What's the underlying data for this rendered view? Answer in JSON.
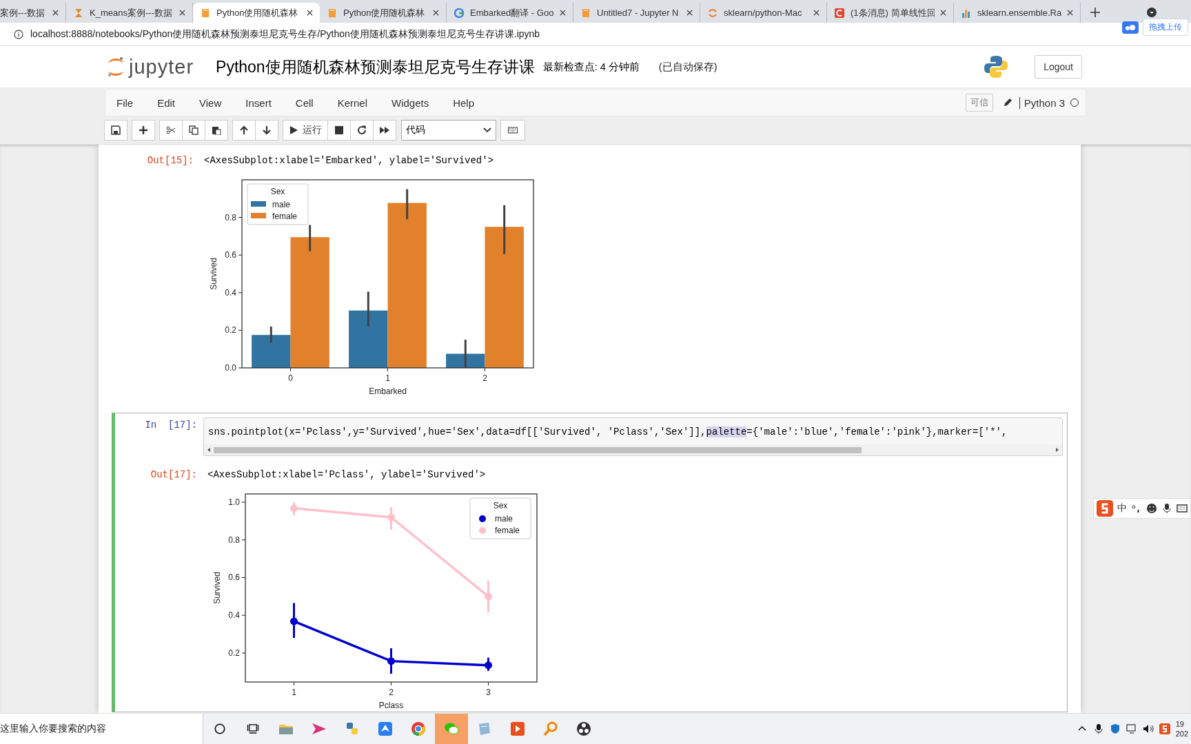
{
  "browser": {
    "tabs": [
      {
        "title": "案例---数据",
        "kind": "none",
        "selected": false
      },
      {
        "title": "K_means案例---数据",
        "kind": "hourglass",
        "selected": false
      },
      {
        "title": "Python使用随机森林",
        "kind": "book",
        "selected": true
      },
      {
        "title": "Python使用随机森林",
        "kind": "book",
        "selected": false
      },
      {
        "title": "Embarked翻译 - Goo",
        "kind": "google",
        "selected": false
      },
      {
        "title": "Untitled7 - Jupyter N",
        "kind": "book",
        "selected": false
      },
      {
        "title": "sklearn/python-Mac",
        "kind": "ring",
        "selected": false
      },
      {
        "title": "(1条消息) 简单线性回",
        "kind": "letter",
        "selected": false
      },
      {
        "title": "sklearn.ensemble.Ra",
        "kind": "bars",
        "selected": false
      }
    ],
    "url": "localhost:8888/notebooks/Python使用随机森林预测泰坦尼克号生存/Python使用随机森林预测泰坦尼克号生存讲课.ipynb",
    "upload_button": "拖拽上传"
  },
  "header": {
    "logo_text": "jupyter",
    "title": "Python使用随机森林预测泰坦尼克号生存讲课",
    "checkpoint": "最新检查点: 4 分钟前",
    "autosave": "(已自动保存)",
    "logout": "Logout"
  },
  "menu": {
    "items": [
      "File",
      "Edit",
      "View",
      "Insert",
      "Cell",
      "Kernel",
      "Widgets",
      "Help"
    ],
    "trusted": "可信",
    "kernel": "Python 3"
  },
  "toolbar": {
    "run": "运行",
    "cell_type": "代码"
  },
  "cells": [
    {
      "kind": "output",
      "prompt": "Out[15]:",
      "text": "<AxesSubplot:xlabel='Embarked', ylabel='Survived'>",
      "chart_data": {
        "type": "bar",
        "legend": {
          "title": "Sex"
        },
        "xlabel": "Embarked",
        "ylabel": "Survived",
        "categories": [
          "0",
          "1",
          "2"
        ],
        "ylim": [
          0,
          1.0
        ],
        "yticks": [
          {
            "value": 0,
            "label": "0.0"
          },
          {
            "value": 0.2,
            "label": "0.2"
          },
          {
            "value": 0.4,
            "label": "0.4"
          },
          {
            "value": 0.6,
            "label": "0.6"
          },
          {
            "value": 0.8,
            "label": "0.8"
          }
        ],
        "series": [
          {
            "name": "male",
            "color": "#3274a1",
            "values": [
              0.175,
              0.305,
              0.075
            ],
            "errors": [
              [
                0.135,
                0.22
              ],
              [
                0.22,
                0.405
              ],
              [
                0,
                0.15
              ]
            ]
          },
          {
            "name": "female",
            "color": "#e1812c",
            "values": [
              0.695,
              0.877,
              0.75
            ],
            "errors": [
              [
                0.62,
                0.76
              ],
              [
                0.79,
                0.95
              ],
              [
                0.605,
                0.865
              ]
            ]
          }
        ]
      }
    },
    {
      "kind": "code",
      "selected": true,
      "prompt": "In  [17]:",
      "code": [
        {
          "text": "sns.pointplot(x='Pclass',y='Survived',hue='Sex',data=df[['Survived', 'Pclass','Sex']],",
          "highlighted": false
        },
        {
          "text": "palette",
          "highlighted": true
        },
        {
          "text": "={'male':'blue','female':'pink'},marker=['*',",
          "highlighted": false
        }
      ],
      "out_prompt": "Out[17]:",
      "text": "<AxesSubplot:xlabel='Pclass', ylabel='Survived'>",
      "chart_data": {
        "type": "line",
        "legend": {
          "title": "Sex"
        },
        "xlabel": "Pclass",
        "ylabel": "Survived",
        "x": [
          1,
          2,
          3
        ],
        "xlim": [
          0.5,
          3.5
        ],
        "ylim": [
          0.046,
          1.044
        ],
        "xticks": [
          1,
          2,
          3
        ],
        "yticks": [
          {
            "value": 0.2,
            "label": "0.2"
          },
          {
            "value": 0.4,
            "label": "0.4"
          },
          {
            "value": 0.6,
            "label": "0.6"
          },
          {
            "value": 0.8,
            "label": "0.8"
          },
          {
            "value": 1.0,
            "label": "1.0"
          }
        ],
        "series": [
          {
            "name": "male",
            "color": "#0000cd",
            "marker": "o",
            "values": [
              0.368,
              0.157,
              0.135
            ],
            "errors": [
              [
                0.28,
                0.465
              ],
              [
                0.09,
                0.225
              ],
              [
                0.105,
                0.175
              ]
            ]
          },
          {
            "name": "female",
            "color": "#ffc0cb",
            "marker": "o",
            "values": [
              0.968,
              0.92,
              0.5
            ],
            "errors": [
              [
                0.93,
                1.0
              ],
              [
                0.855,
                0.975
              ],
              [
                0.415,
                0.585
              ]
            ]
          }
        ]
      }
    }
  ],
  "ime": {
    "mode": "中"
  },
  "taskbar": {
    "search_placeholder": "这里输入你要搜索的内容",
    "apps": [
      {
        "kind": "folder",
        "selected": false
      },
      {
        "kind": "plane",
        "selected": false
      },
      {
        "kind": "python",
        "selected": false
      },
      {
        "kind": "bird",
        "selected": false
      },
      {
        "kind": "chrome",
        "selected": false
      },
      {
        "kind": "chat",
        "selected": true
      },
      {
        "kind": "note",
        "selected": false
      },
      {
        "kind": "play",
        "selected": false
      },
      {
        "kind": "magnifier",
        "selected": false
      },
      {
        "kind": "obs",
        "selected": false
      }
    ],
    "clock": [
      "19",
      "202"
    ]
  }
}
